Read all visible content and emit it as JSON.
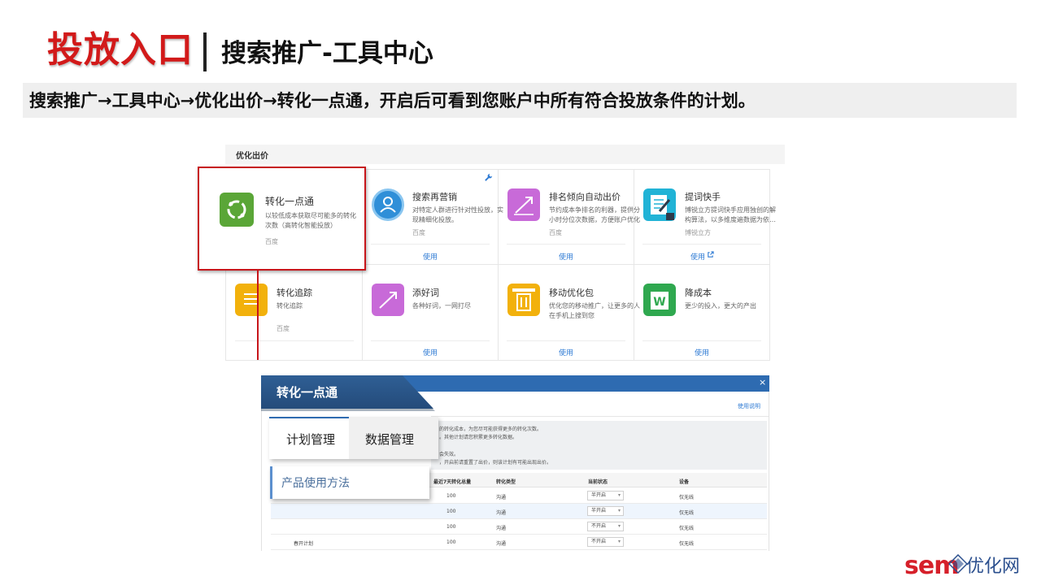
{
  "header": {
    "title": "投放入口",
    "subtitle": "搜索推广-工具中心",
    "description": "搜索推广→工具中心→优化出价→转化一点通，开启后可看到您账户中所有符合投放条件的计划。"
  },
  "tool_center": {
    "section_title": "优化出价",
    "tiles": [
      {
        "title": "转化一点通",
        "desc1": "以较低成本获取尽可能多的转化",
        "desc2": "次数（高转化智能投放）",
        "source": "百度",
        "action": "",
        "color": "#5aa637"
      },
      {
        "title": "搜索再营销",
        "desc1": "对特定人群进行针对性投放，实",
        "desc2": "现精细化投放。",
        "source": "百度",
        "action": "使用",
        "color": "#2f8fd8"
      },
      {
        "title": "排名倾向自动出价",
        "desc1": "节约成本争排名的利器，提供分",
        "desc2": "小时分位次数据，方便账户优化",
        "source": "百度",
        "action": "使用",
        "color": "#c86ad8"
      },
      {
        "title": "提词快手",
        "desc1": "博锐立方提词快手应用独创的解",
        "desc2": "构算法，以多维度遍数据为依…",
        "source": "博锐立方",
        "action": "使用",
        "color": "#21b3d6"
      },
      {
        "title": "转化追踪",
        "desc1": "转化追踪",
        "desc2": "",
        "source": "百度",
        "action": "",
        "color": "#f2b10c"
      },
      {
        "title": "添好词",
        "desc1": "各种好词，一网打尽",
        "desc2": "",
        "source": "",
        "action": "使用",
        "color": "#c86ad8"
      },
      {
        "title": "移动优化包",
        "desc1": "优化您的移动推广，让更多的人",
        "desc2": "在手机上搜到您",
        "source": "",
        "action": "使用",
        "color": "#f2b10c"
      },
      {
        "title": "降成本",
        "desc1": "更少的投入，更大的产出",
        "desc2": "",
        "source": "",
        "action": "使用",
        "color": "#2fa84f"
      }
    ]
  },
  "dialog": {
    "title": "转化一点通",
    "close_symbol": "×",
    "help_link": "使用说明",
    "tabs": [
      {
        "label": "计划管理",
        "active": true
      },
      {
        "label": "数据管理",
        "active": false
      }
    ],
    "method_label": "产品使用方法",
    "notice": [
      "的转化成本，为您尽可能获得更多的转化次数。",
      "。其他计划请您积累更多转化数据。",
      "会失效。",
      "，开启前请重置了出价，则该计划有可能出现出价。"
    ],
    "table": {
      "headers": [
        "最近7天转化总量",
        "转化类型",
        "当前状态",
        "设备"
      ],
      "rows": [
        {
          "plan": "",
          "count": "100",
          "type": "沟通",
          "status": "半开启",
          "device": "仅无线"
        },
        {
          "plan": "",
          "count": "100",
          "type": "沟通",
          "status": "半开启",
          "device": "仅无线"
        },
        {
          "plan": "",
          "count": "100",
          "type": "沟通",
          "status": "不开启",
          "device": "仅无线"
        },
        {
          "plan": "春开计划",
          "count": "100",
          "type": "沟通",
          "status": "不开启",
          "device": "仅无线"
        }
      ]
    }
  },
  "logo": {
    "brand_latin": "sem",
    "brand_cn": "优化网"
  }
}
